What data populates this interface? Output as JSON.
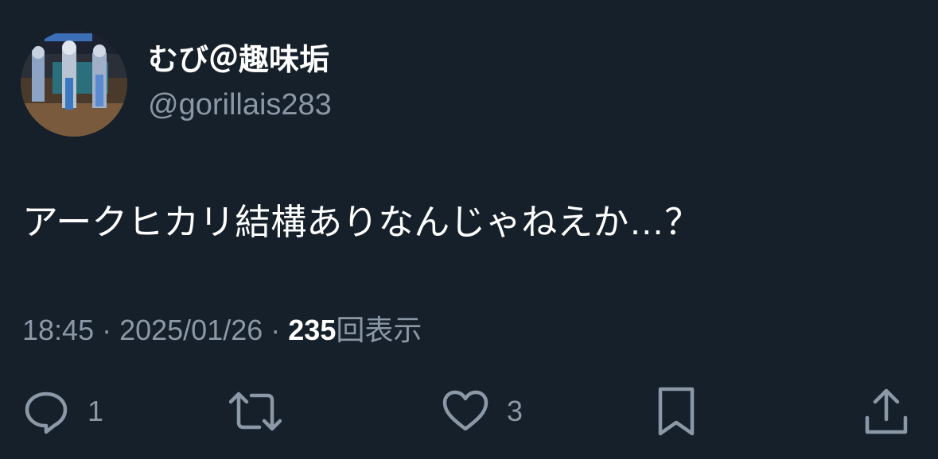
{
  "tweet": {
    "author": {
      "display_name": "むび＠趣味垢",
      "handle": "@gorillais283"
    },
    "text": "アークヒカリ結構ありなんじゃねえか…？",
    "meta": {
      "time": "18:45",
      "separator": "·",
      "date": "2025/01/26",
      "views_count": "235",
      "views_label": "回表示"
    },
    "actions": {
      "reply": {
        "icon": "reply-icon",
        "count": "1"
      },
      "retweet": {
        "icon": "retweet-icon"
      },
      "like": {
        "icon": "heart-icon",
        "count": "3"
      },
      "bookmark": {
        "icon": "bookmark-icon"
      },
      "share": {
        "icon": "share-icon"
      }
    }
  },
  "colors": {
    "background": "#15202b",
    "text_primary": "#ffffff",
    "text_secondary": "#8b98a5"
  }
}
